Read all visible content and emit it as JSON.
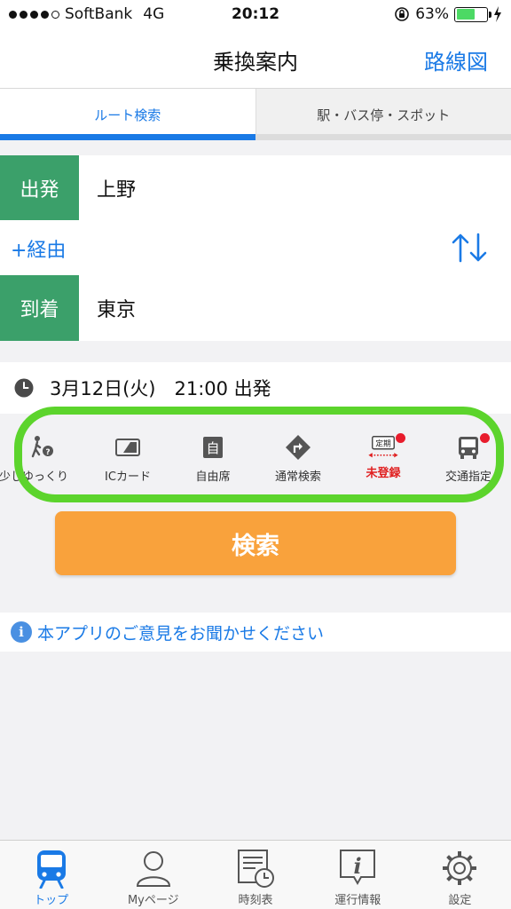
{
  "status_bar": {
    "carrier": "SoftBank",
    "network": "4G",
    "time": "20:12",
    "battery": "63%",
    "battery_level": 0.63
  },
  "nav": {
    "title": "乗換案内",
    "right_button": "路線図"
  },
  "tabs": [
    {
      "label": "ルート検索",
      "active": true
    },
    {
      "label": "駅・バス停・スポット",
      "active": false
    }
  ],
  "departure": {
    "label": "出発",
    "value": "上野"
  },
  "via": {
    "label": "+経由"
  },
  "arrival": {
    "label": "到着",
    "value": "東京"
  },
  "datetime": {
    "text": "3月12日(火)　21:00 出発"
  },
  "options": [
    {
      "label": "少しゆっくり",
      "icon": "walking-speed-icon"
    },
    {
      "label": "ICカード",
      "icon": "ic-card-icon"
    },
    {
      "label": "自由席",
      "icon": "free-seat-icon"
    },
    {
      "label": "通常検索",
      "icon": "route-sign-icon"
    },
    {
      "label": "未登録",
      "icon": "commuter-pass-icon",
      "badge_text": "定期"
    },
    {
      "label": "交通指定",
      "icon": "bus-icon"
    }
  ],
  "search_button": {
    "label": "検索"
  },
  "feedback": {
    "text": "本アプリのご意見をお聞かせください"
  },
  "tabbar": [
    {
      "label": "トップ",
      "icon": "train-icon",
      "active": true
    },
    {
      "label": "Myページ",
      "icon": "user-icon",
      "active": false
    },
    {
      "label": "時刻表",
      "icon": "timetable-icon",
      "active": false
    },
    {
      "label": "運行情報",
      "icon": "info-icon",
      "active": false
    },
    {
      "label": "設定",
      "icon": "gear-icon",
      "active": false
    }
  ],
  "colors": {
    "accent": "#1a7ae6",
    "station_label": "#3ba06a",
    "search_button": "#f9a23c",
    "highlight": "#5cd42c",
    "badge_red": "#e81c2c"
  }
}
